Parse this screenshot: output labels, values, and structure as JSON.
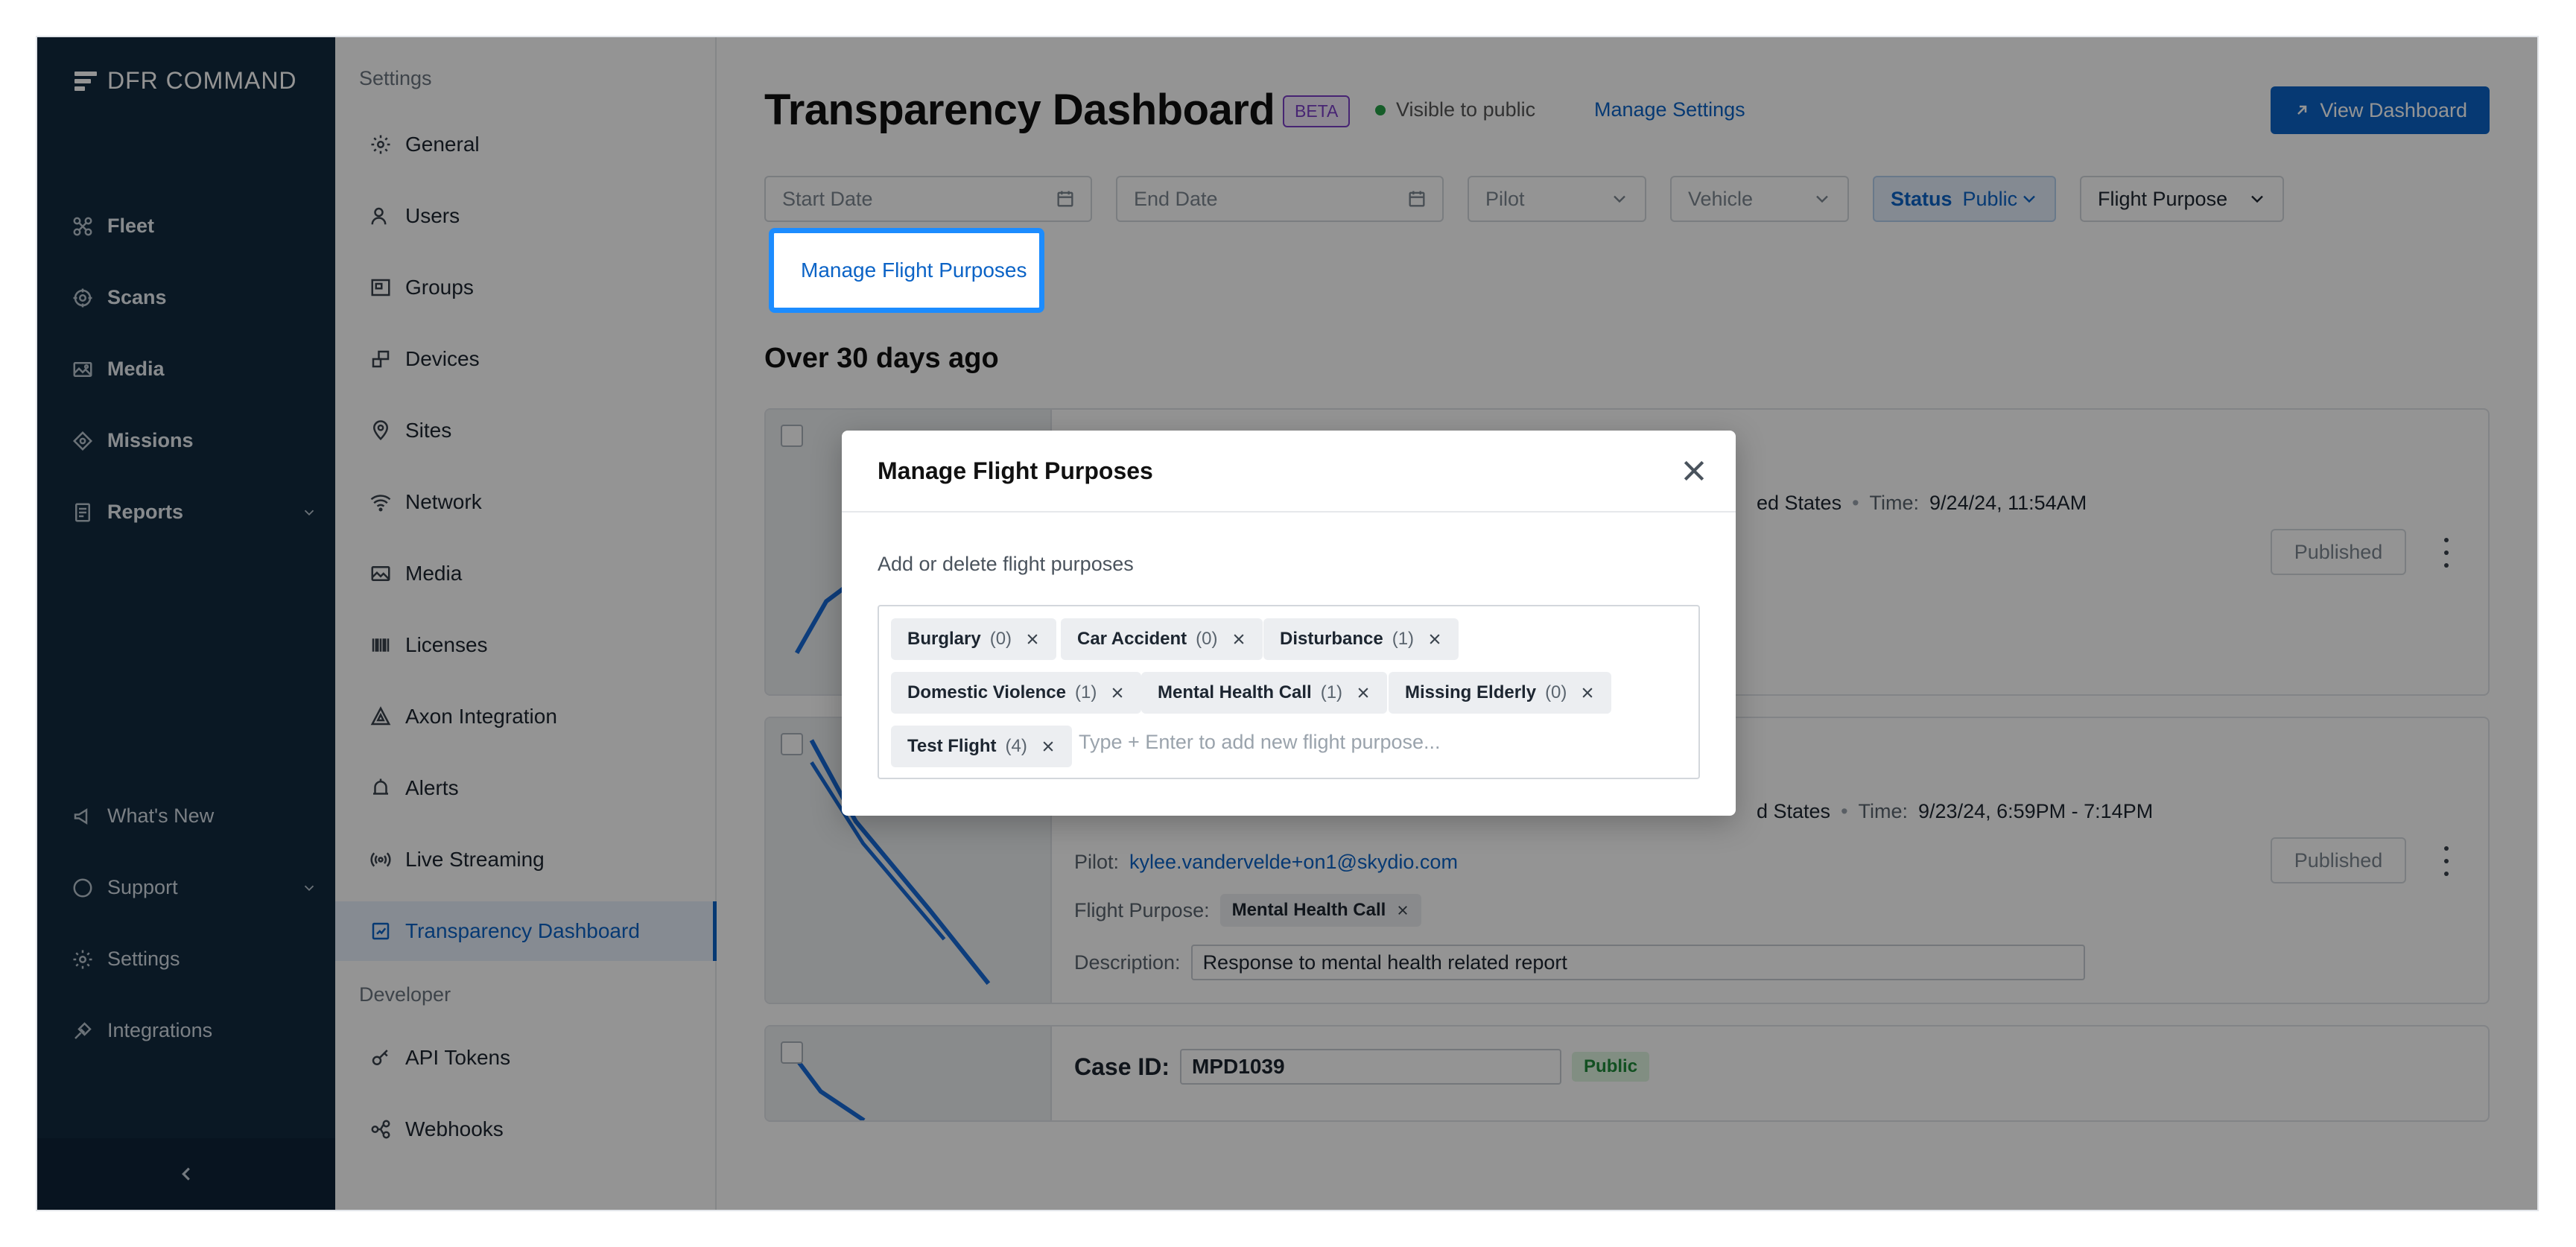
{
  "nav": {
    "logo": "DFR COMMAND",
    "items": [
      {
        "label": "Fleet",
        "icon": "drone-icon"
      },
      {
        "label": "Scans",
        "icon": "scan-icon"
      },
      {
        "label": "Media",
        "icon": "image-icon"
      },
      {
        "label": "Missions",
        "icon": "target-icon"
      },
      {
        "label": "Reports",
        "icon": "report-icon"
      }
    ],
    "bottom_items": [
      {
        "label": "What's New",
        "icon": "megaphone-icon"
      },
      {
        "label": "Support",
        "icon": "chat-icon"
      },
      {
        "label": "Settings",
        "icon": "gear-icon"
      },
      {
        "label": "Integrations",
        "icon": "plug-icon"
      }
    ]
  },
  "settings": {
    "section_label": "Settings",
    "items": [
      {
        "label": "General"
      },
      {
        "label": "Users"
      },
      {
        "label": "Groups"
      },
      {
        "label": "Devices"
      },
      {
        "label": "Sites"
      },
      {
        "label": "Network"
      },
      {
        "label": "Media"
      },
      {
        "label": "Licenses"
      },
      {
        "label": "Axon Integration"
      },
      {
        "label": "Alerts"
      },
      {
        "label": "Live Streaming"
      },
      {
        "label": "Transparency Dashboard"
      }
    ],
    "developer_label": "Developer",
    "developer_items": [
      {
        "label": "API Tokens"
      },
      {
        "label": "Webhooks"
      }
    ]
  },
  "header": {
    "title": "Transparency Dashboard",
    "beta": "BETA",
    "visibility": "Visible to public",
    "manage_settings": "Manage Settings",
    "view_dashboard": "View Dashboard"
  },
  "filters": {
    "start_date": "Start Date",
    "end_date": "End Date",
    "pilot": "Pilot",
    "vehicle": "Vehicle",
    "status_label": "Status",
    "status_value": "Public",
    "flight_purpose": "Flight Purpose"
  },
  "manage_flight_purposes_link": "Manage Flight Purposes",
  "section_title": "Over 30 days ago",
  "cards": [
    {
      "location_tail": "ed States",
      "time_label": "Time:",
      "time": "9/24/24, 11:54AM",
      "status": "Published"
    },
    {
      "location_tail": "d States",
      "time_label": "Time:",
      "time": "9/23/24, 6:59PM - 7:14PM",
      "pilot_label": "Pilot:",
      "pilot": "kylee.vandervelde+on1@skydio.com",
      "purpose_label": "Flight Purpose:",
      "purpose": "Mental Health Call",
      "description_label": "Description:",
      "description": "Response to mental health related report",
      "status": "Published"
    },
    {
      "case_label": "Case ID:",
      "case_id": "MPD1039",
      "badge": "Public"
    }
  ],
  "modal": {
    "title": "Manage Flight Purposes",
    "subtitle": "Add or delete flight purposes",
    "tags": [
      {
        "name": "Burglary",
        "count": "(0)"
      },
      {
        "name": "Car Accident",
        "count": "(0)"
      },
      {
        "name": "Disturbance",
        "count": "(1)"
      },
      {
        "name": "Domestic Violence",
        "count": "(1)"
      },
      {
        "name": "Mental Health Call",
        "count": "(1)"
      },
      {
        "name": "Missing Elderly",
        "count": "(0)"
      },
      {
        "name": "Test Flight",
        "count": "(4)"
      }
    ],
    "input_placeholder": "Type + Enter to add new flight purpose..."
  },
  "colors": {
    "nav_bg": "#122a3f",
    "accent": "#0b63c6",
    "beta": "#7b3fc7",
    "public_green": "#1f8a3a",
    "highlight": "#1c8cff"
  }
}
